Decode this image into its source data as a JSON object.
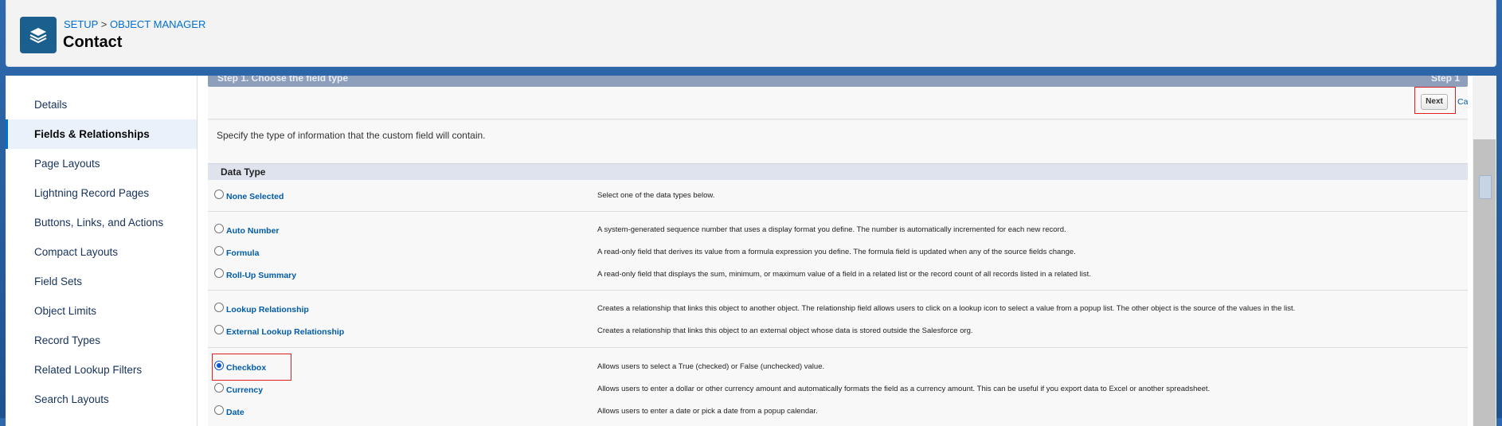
{
  "header": {
    "breadcrumb": [
      "SETUP",
      "OBJECT MANAGER"
    ],
    "breadcrumb_sep": ">",
    "title": "Contact",
    "icon": "layers-icon"
  },
  "sidebar": {
    "items": [
      {
        "label": "Details",
        "active": false
      },
      {
        "label": "Fields & Relationships",
        "active": true
      },
      {
        "label": "Page Layouts",
        "active": false
      },
      {
        "label": "Lightning Record Pages",
        "active": false
      },
      {
        "label": "Buttons, Links, and Actions",
        "active": false
      },
      {
        "label": "Compact Layouts",
        "active": false
      },
      {
        "label": "Field Sets",
        "active": false
      },
      {
        "label": "Object Limits",
        "active": false
      },
      {
        "label": "Record Types",
        "active": false
      },
      {
        "label": "Related Lookup Filters",
        "active": false
      },
      {
        "label": "Search Layouts",
        "active": false
      }
    ]
  },
  "wizard": {
    "step_title": "Step 1. Choose the field type",
    "step_count": "Step 1",
    "next_label": "Next",
    "cancel_label": "Cancel",
    "instruction": "Specify the type of information that the custom field will contain.",
    "data_type_header": "Data Type",
    "options": [
      {
        "label": "None Selected",
        "desc": "Select one of the data types below.",
        "checked": false
      },
      {
        "label": "Auto Number",
        "desc": "A system-generated sequence number that uses a display format you define. The number is automatically incremented for each new record.",
        "checked": false
      },
      {
        "label": "Formula",
        "desc": "A read-only field that derives its value from a formula expression you define. The formula field is updated when any of the source fields change.",
        "checked": false
      },
      {
        "label": "Roll-Up Summary",
        "desc": "A read-only field that displays the sum, minimum, or maximum value of a field in a related list or the record count of all records listed in a related list.",
        "checked": false
      },
      {
        "label": "Lookup Relationship",
        "desc": "Creates a relationship that links this object to another object. The relationship field allows users to click on a lookup icon to select a value from a popup list. The other object is the source of the values in the list.",
        "checked": false
      },
      {
        "label": "External Lookup Relationship",
        "desc": "Creates a relationship that links this object to an external object whose data is stored outside the Salesforce org.",
        "checked": false
      },
      {
        "label": "Checkbox",
        "desc": "Allows users to select a True (checked) or False (unchecked) value.",
        "checked": true
      },
      {
        "label": "Currency",
        "desc": "Allows users to enter a dollar or other currency amount and automatically formats the field as a currency amount. This can be useful if you export data to Excel or another spreadsheet.",
        "checked": false
      },
      {
        "label": "Date",
        "desc": "Allows users to enter a date or pick a date from a popup calendar.",
        "checked": false
      }
    ]
  }
}
